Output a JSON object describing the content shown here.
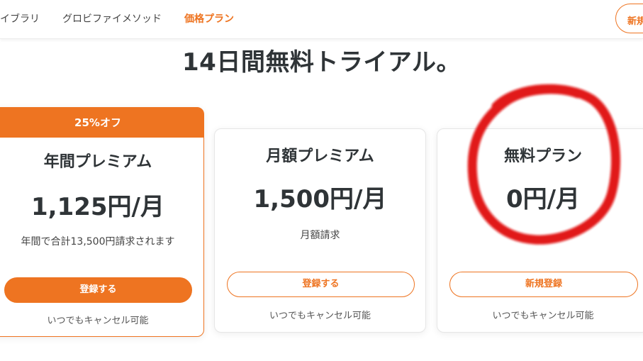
{
  "nav": {
    "items": [
      {
        "label": "イブラリ",
        "active": false
      },
      {
        "label": "グロビファイメソッド",
        "active": false
      },
      {
        "label": "価格プラン",
        "active": true
      }
    ],
    "signup_label": "新規"
  },
  "headline": "14日間無料トライアル。",
  "plans": [
    {
      "badge": "25%オフ",
      "name": "年間プレミアム",
      "price": "1,125円/月",
      "note": "年間で合計13,500円請求されます",
      "button": "登録する",
      "cancel": "いつでもキャンセル可能"
    },
    {
      "name": "月額プレミアム",
      "price": "1,500円/月",
      "note": "月額請求",
      "button": "登録する",
      "cancel": "いつでもキャンセル可能"
    },
    {
      "name": "無料プラン",
      "price": "0円/月",
      "button": "新規登録",
      "cancel": "いつでもキャンセル可能"
    }
  ],
  "colors": {
    "accent": "#ee7421",
    "annotation": "#e01010"
  }
}
